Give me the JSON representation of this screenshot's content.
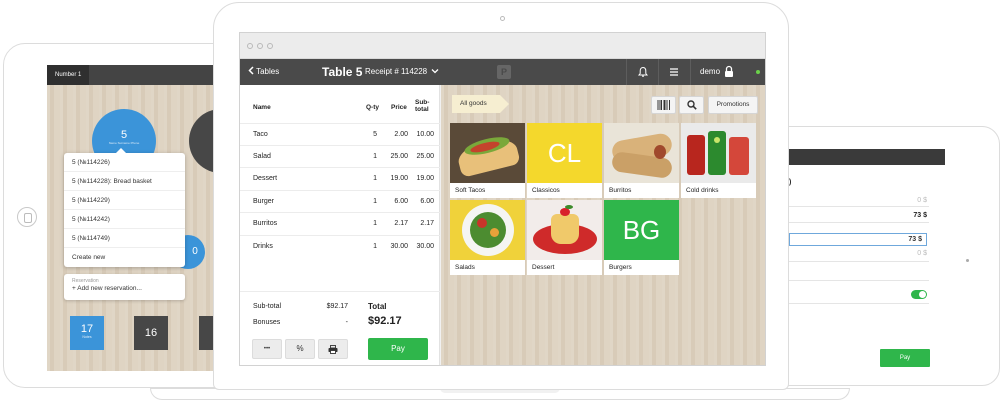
{
  "left_tablet": {
    "tab_label": "Number 1",
    "tables": [
      {
        "label": "5",
        "sub": "Name Surname Phone"
      },
      {
        "label": "0"
      },
      {
        "label": "17",
        "sub": "Notes"
      },
      {
        "label": "16"
      }
    ],
    "reservations": [
      "5 (№114226)",
      "5 (№114228): Bread basket",
      "5 (№114229)",
      "5 (№114242)",
      "5 (№114749)"
    ],
    "create_new": "Create new",
    "reservation_caption": "Reservation",
    "add_reservation": "+ Add new reservation..."
  },
  "right_tablet": {
    "values": [
      "0 $",
      "73 $",
      "73 $",
      "0 $"
    ],
    "pay_label": "Pay",
    "toggle_on": true
  },
  "app": {
    "back_label": "Tables",
    "table_title": "Table 5",
    "receipt_label": "Receipt # 114228",
    "logo": "P",
    "user": "demo",
    "colors": {
      "header": "#4a4a4a",
      "accent": "#2fb64b",
      "status": "#6bd24a"
    }
  },
  "order": {
    "headers": {
      "name": "Name",
      "qty": "Q-ty",
      "price": "Price",
      "subtotal_1": "Sub-",
      "subtotal_2": "total"
    },
    "items": [
      {
        "name": "Taco",
        "qty": "5",
        "price": "2.00",
        "subtotal": "10.00"
      },
      {
        "name": "Salad",
        "qty": "1",
        "price": "25.00",
        "subtotal": "25.00"
      },
      {
        "name": "Dessert",
        "qty": "1",
        "price": "19.00",
        "subtotal": "19.00"
      },
      {
        "name": "Burger",
        "qty": "1",
        "price": "6.00",
        "subtotal": "6.00"
      },
      {
        "name": "Burritos",
        "qty": "1",
        "price": "2.17",
        "subtotal": "2.17"
      },
      {
        "name": "Drinks",
        "qty": "1",
        "price": "30.00",
        "subtotal": "30.00"
      }
    ],
    "subtotal_label": "Sub-total",
    "subtotal_value": "$92.17",
    "bonuses_label": "Bonuses",
    "bonuses_value": "-",
    "total_label": "Total",
    "total_value": "$92.17",
    "more_label": "•••",
    "percent_label": "%",
    "pay_label": "Pay"
  },
  "goods": {
    "category": "All goods",
    "promotions_label": "Promotions",
    "tiles": [
      {
        "label": "Soft Tacos",
        "kind": "photo-tacos"
      },
      {
        "label": "Classicos",
        "kind": "abbr",
        "abbr": "CL",
        "color": "#f4d82c"
      },
      {
        "label": "Burritos",
        "kind": "photo-burritos"
      },
      {
        "label": "Cold drinks",
        "kind": "photo-drinks"
      },
      {
        "label": "Salads",
        "kind": "photo-salad"
      },
      {
        "label": "Dessert",
        "kind": "photo-dessert"
      },
      {
        "label": "Burgers",
        "kind": "abbr",
        "abbr": "BG",
        "color": "#2fb64b"
      }
    ]
  }
}
